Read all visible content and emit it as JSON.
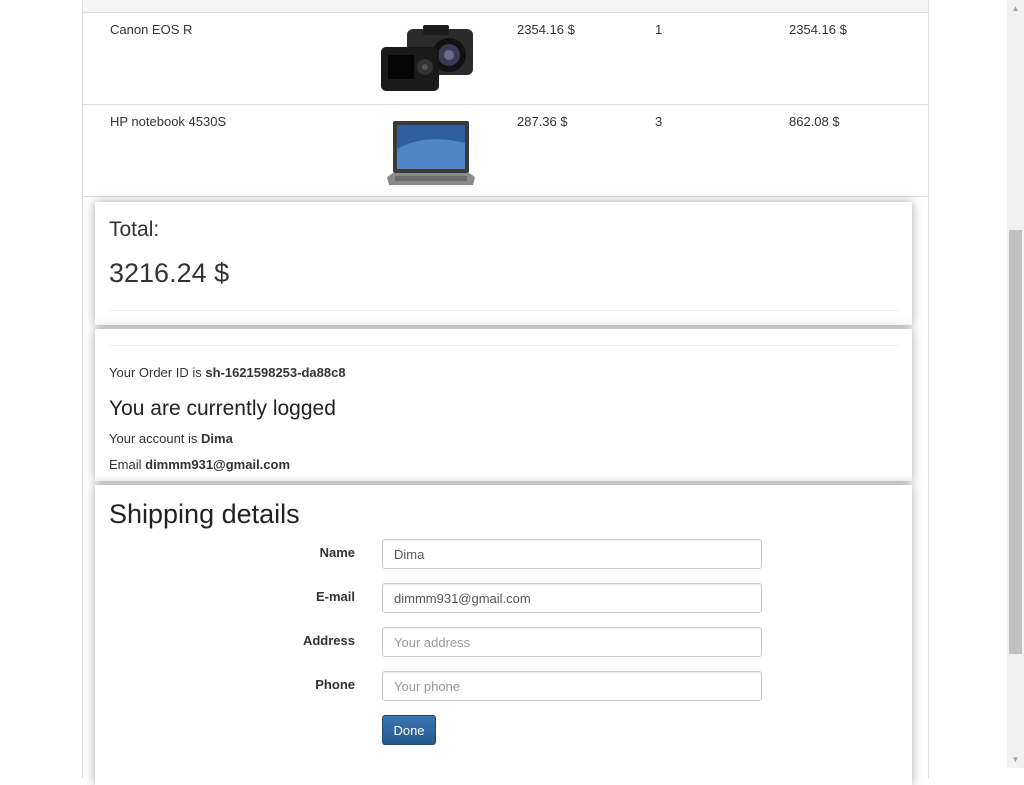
{
  "cart": {
    "rows": [
      {
        "name": "Canon EOS R",
        "price": "2354.16 $",
        "qty": "1",
        "sum": "2354.16 $",
        "image": "camera-image"
      },
      {
        "name": "HP notebook 4530S",
        "price": "287.36 $",
        "qty": "3",
        "sum": "862.08 $",
        "image": "laptop-image"
      }
    ]
  },
  "total": {
    "label": "Total:",
    "value": "3216.24 $"
  },
  "order": {
    "id_prefix": "Your Order ID is ",
    "id": "sh-1621598253-da88c8",
    "logged_title": "You are currently logged",
    "account_prefix": "Your account is ",
    "account": "Dima",
    "email_prefix": "Email ",
    "email": "dimmm931@gmail.com"
  },
  "shipping": {
    "title": "Shipping details",
    "fields": {
      "name": {
        "label": "Name",
        "value": "Dima",
        "placeholder": ""
      },
      "email": {
        "label": "E-mail",
        "value": "dimmm931@gmail.com",
        "placeholder": ""
      },
      "address": {
        "label": "Address",
        "value": "",
        "placeholder": "Your address"
      },
      "phone": {
        "label": "Phone",
        "value": "",
        "placeholder": "Your phone"
      }
    },
    "done_label": "Done"
  },
  "colors": {
    "button": "#2a5f95"
  }
}
